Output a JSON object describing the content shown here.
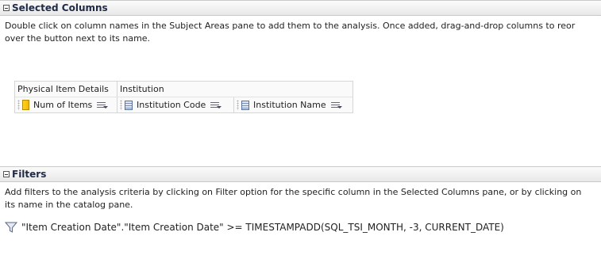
{
  "selected_columns": {
    "title": "Selected Columns",
    "instructions_line1": "Double click on column names in the Subject Areas pane to add them to the analysis. Once added, drag-and-drop columns to reor",
    "instructions_line2": "over the button next to its name.",
    "groups": [
      "Physical Item Details",
      "Institution"
    ],
    "columns": [
      {
        "label": "Num of Items",
        "icon": "measure-icon"
      },
      {
        "label": "Institution Code",
        "icon": "attribute-column-icon"
      },
      {
        "label": "Institution Name",
        "icon": "attribute-column-icon"
      }
    ]
  },
  "filters": {
    "title": "Filters",
    "instructions_line1": "Add filters to the analysis criteria by clicking on Filter option for the specific column in the Selected Columns pane, or by clicking on",
    "instructions_line2": "its name in the catalog pane.",
    "items": [
      {
        "expression": "\"Item Creation Date\".\"Item Creation Date\" >= TIMESTAMPADD(SQL_TSI_MONTH, -3, CURRENT_DATE)"
      }
    ]
  }
}
